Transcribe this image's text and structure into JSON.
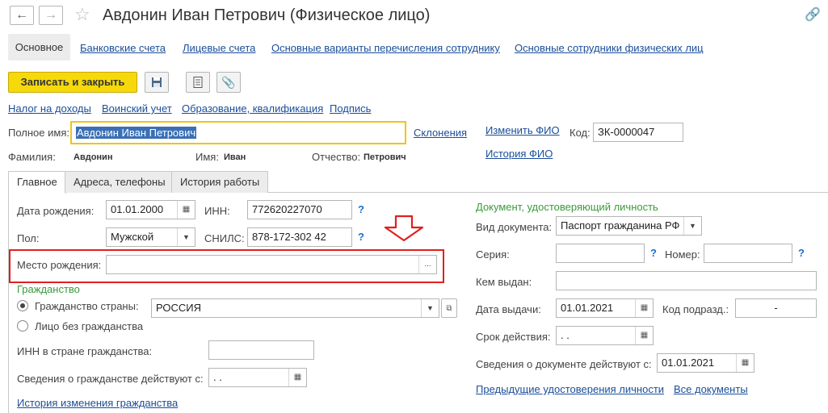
{
  "window": {
    "title": "Авдонин Иван Петрович (Физическое лицо)"
  },
  "nav_tabs": [
    "Основное",
    "Банковские счета",
    "Лицевые счета",
    "Основные варианты перечисления сотруднику",
    "Основные сотрудники физических лиц"
  ],
  "toolbar": {
    "save_close_label": "Записать и закрыть"
  },
  "sublinks": [
    "Налог на доходы",
    "Воинский учет",
    "Образование, квалификация",
    "Подпись"
  ],
  "header": {
    "fullname_label": "Полное имя:",
    "fullname_value": "Авдонин Иван Петрович",
    "declensions_link": "Склонения",
    "change_fio_link": "Изменить ФИО",
    "history_fio_link": "История ФИО",
    "code_label": "Код:",
    "code_value": "ЗК-0000047",
    "surname_label": "Фамилия:",
    "surname_value": "Авдонин",
    "name_label": "Имя:",
    "name_value": "Иван",
    "patronymic_label": "Отчество:",
    "patronymic_value": "Петрович"
  },
  "inner_tabs": [
    "Главное",
    "Адреса, телефоны",
    "История работы"
  ],
  "main": {
    "birthdate_label": "Дата рождения:",
    "birthdate_value": "01.01.2000",
    "inn_label": "ИНН:",
    "inn_value": "772620227070",
    "gender_label": "Пол:",
    "gender_value": "Мужской",
    "snils_label": "СНИЛС:",
    "snils_value": "878-172-302 42",
    "birthplace_label": "Место рождения:",
    "birthplace_value": "",
    "citizenship_header": "Гражданство",
    "citizen_country_label": "Гражданство страны:",
    "citizen_country_value": "РОССИЯ",
    "stateless_label": "Лицо без гражданства",
    "inn_country_label": "ИНН в стране гражданства:",
    "citizen_since_label": "Сведения о гражданстве действуют с:",
    "citizen_since_value": " .  .",
    "citizen_history_link": "История изменения гражданства",
    "q": "?"
  },
  "document": {
    "header": "Документ, удостоверяющий личность",
    "type_label": "Вид документа:",
    "type_value": "Паспорт гражданина РФ",
    "series_label": "Серия:",
    "number_label": "Номер:",
    "issued_by_label": "Кем выдан:",
    "issue_date_label": "Дата выдачи:",
    "issue_date_value": "01.01.2021",
    "division_label": "Код подразд.:",
    "division_value": "-",
    "validity_label": "Срок действия:",
    "validity_value": " .  .",
    "valid_from_label": "Сведения о документе действуют с:",
    "valid_from_value": "01.01.2021",
    "prev_docs_link": "Предыдущие удостоверения личности",
    "all_docs_link": "Все документы"
  },
  "colors": {
    "accent_yellow": "#f5d90a",
    "link": "#1a4e9a",
    "highlight_red": "#e0201e",
    "green": "#3a9a3a"
  }
}
